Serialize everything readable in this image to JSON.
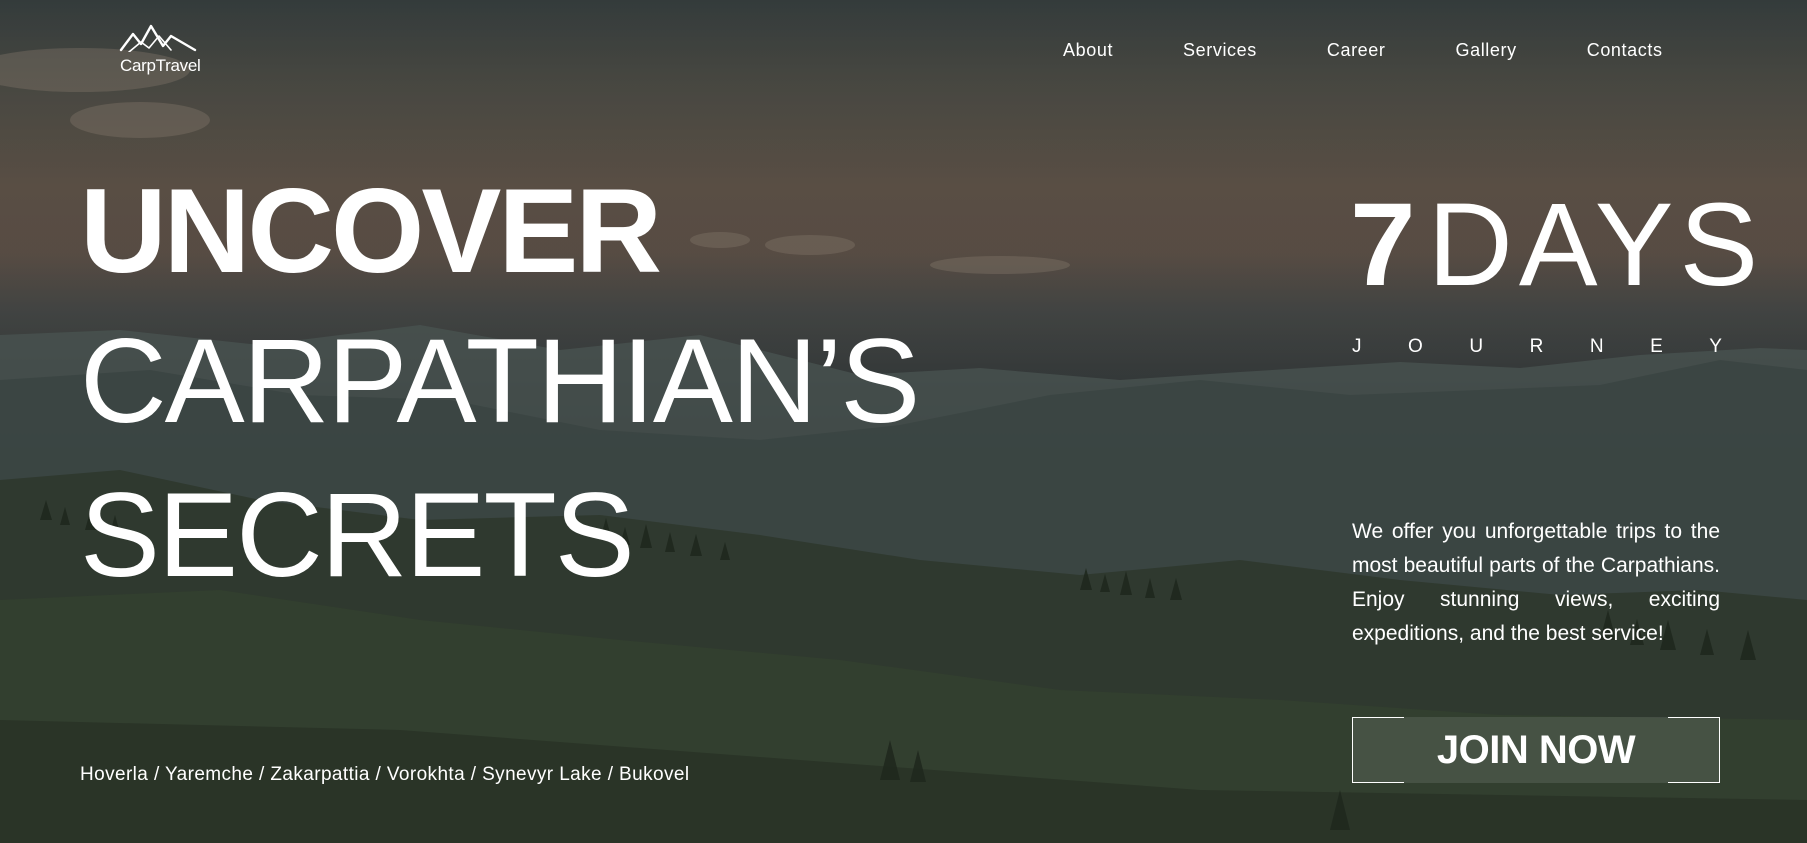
{
  "brand": {
    "logo_text": "CarpTravel",
    "logo_icon": "mountain-icon"
  },
  "nav": {
    "items": [
      {
        "label": "About"
      },
      {
        "label": "Services"
      },
      {
        "label": "Career"
      },
      {
        "label": "Gallery"
      },
      {
        "label": "Contacts"
      }
    ]
  },
  "hero": {
    "line1": "UNCOVER",
    "line2": "CARPATHIAN’S",
    "line3": "SECRETS",
    "locations": "Hoverla / Yaremche / Zakarpattia / Vorokhta / Synevyr Lake / Bukovel"
  },
  "promo": {
    "days_number": "7",
    "days_word": "DAYS",
    "journey_letters": [
      "J",
      "O",
      "U",
      "R",
      "N",
      "E",
      "Y"
    ],
    "description": "We offer you unforgettable trips to the most beautiful parts of the Carpathians. Enjoy stunning views, exciting expeditions, and the best service!",
    "cta_label": "JOIN NOW"
  },
  "colors": {
    "text": "#ffffff",
    "overlay": "#000000"
  }
}
